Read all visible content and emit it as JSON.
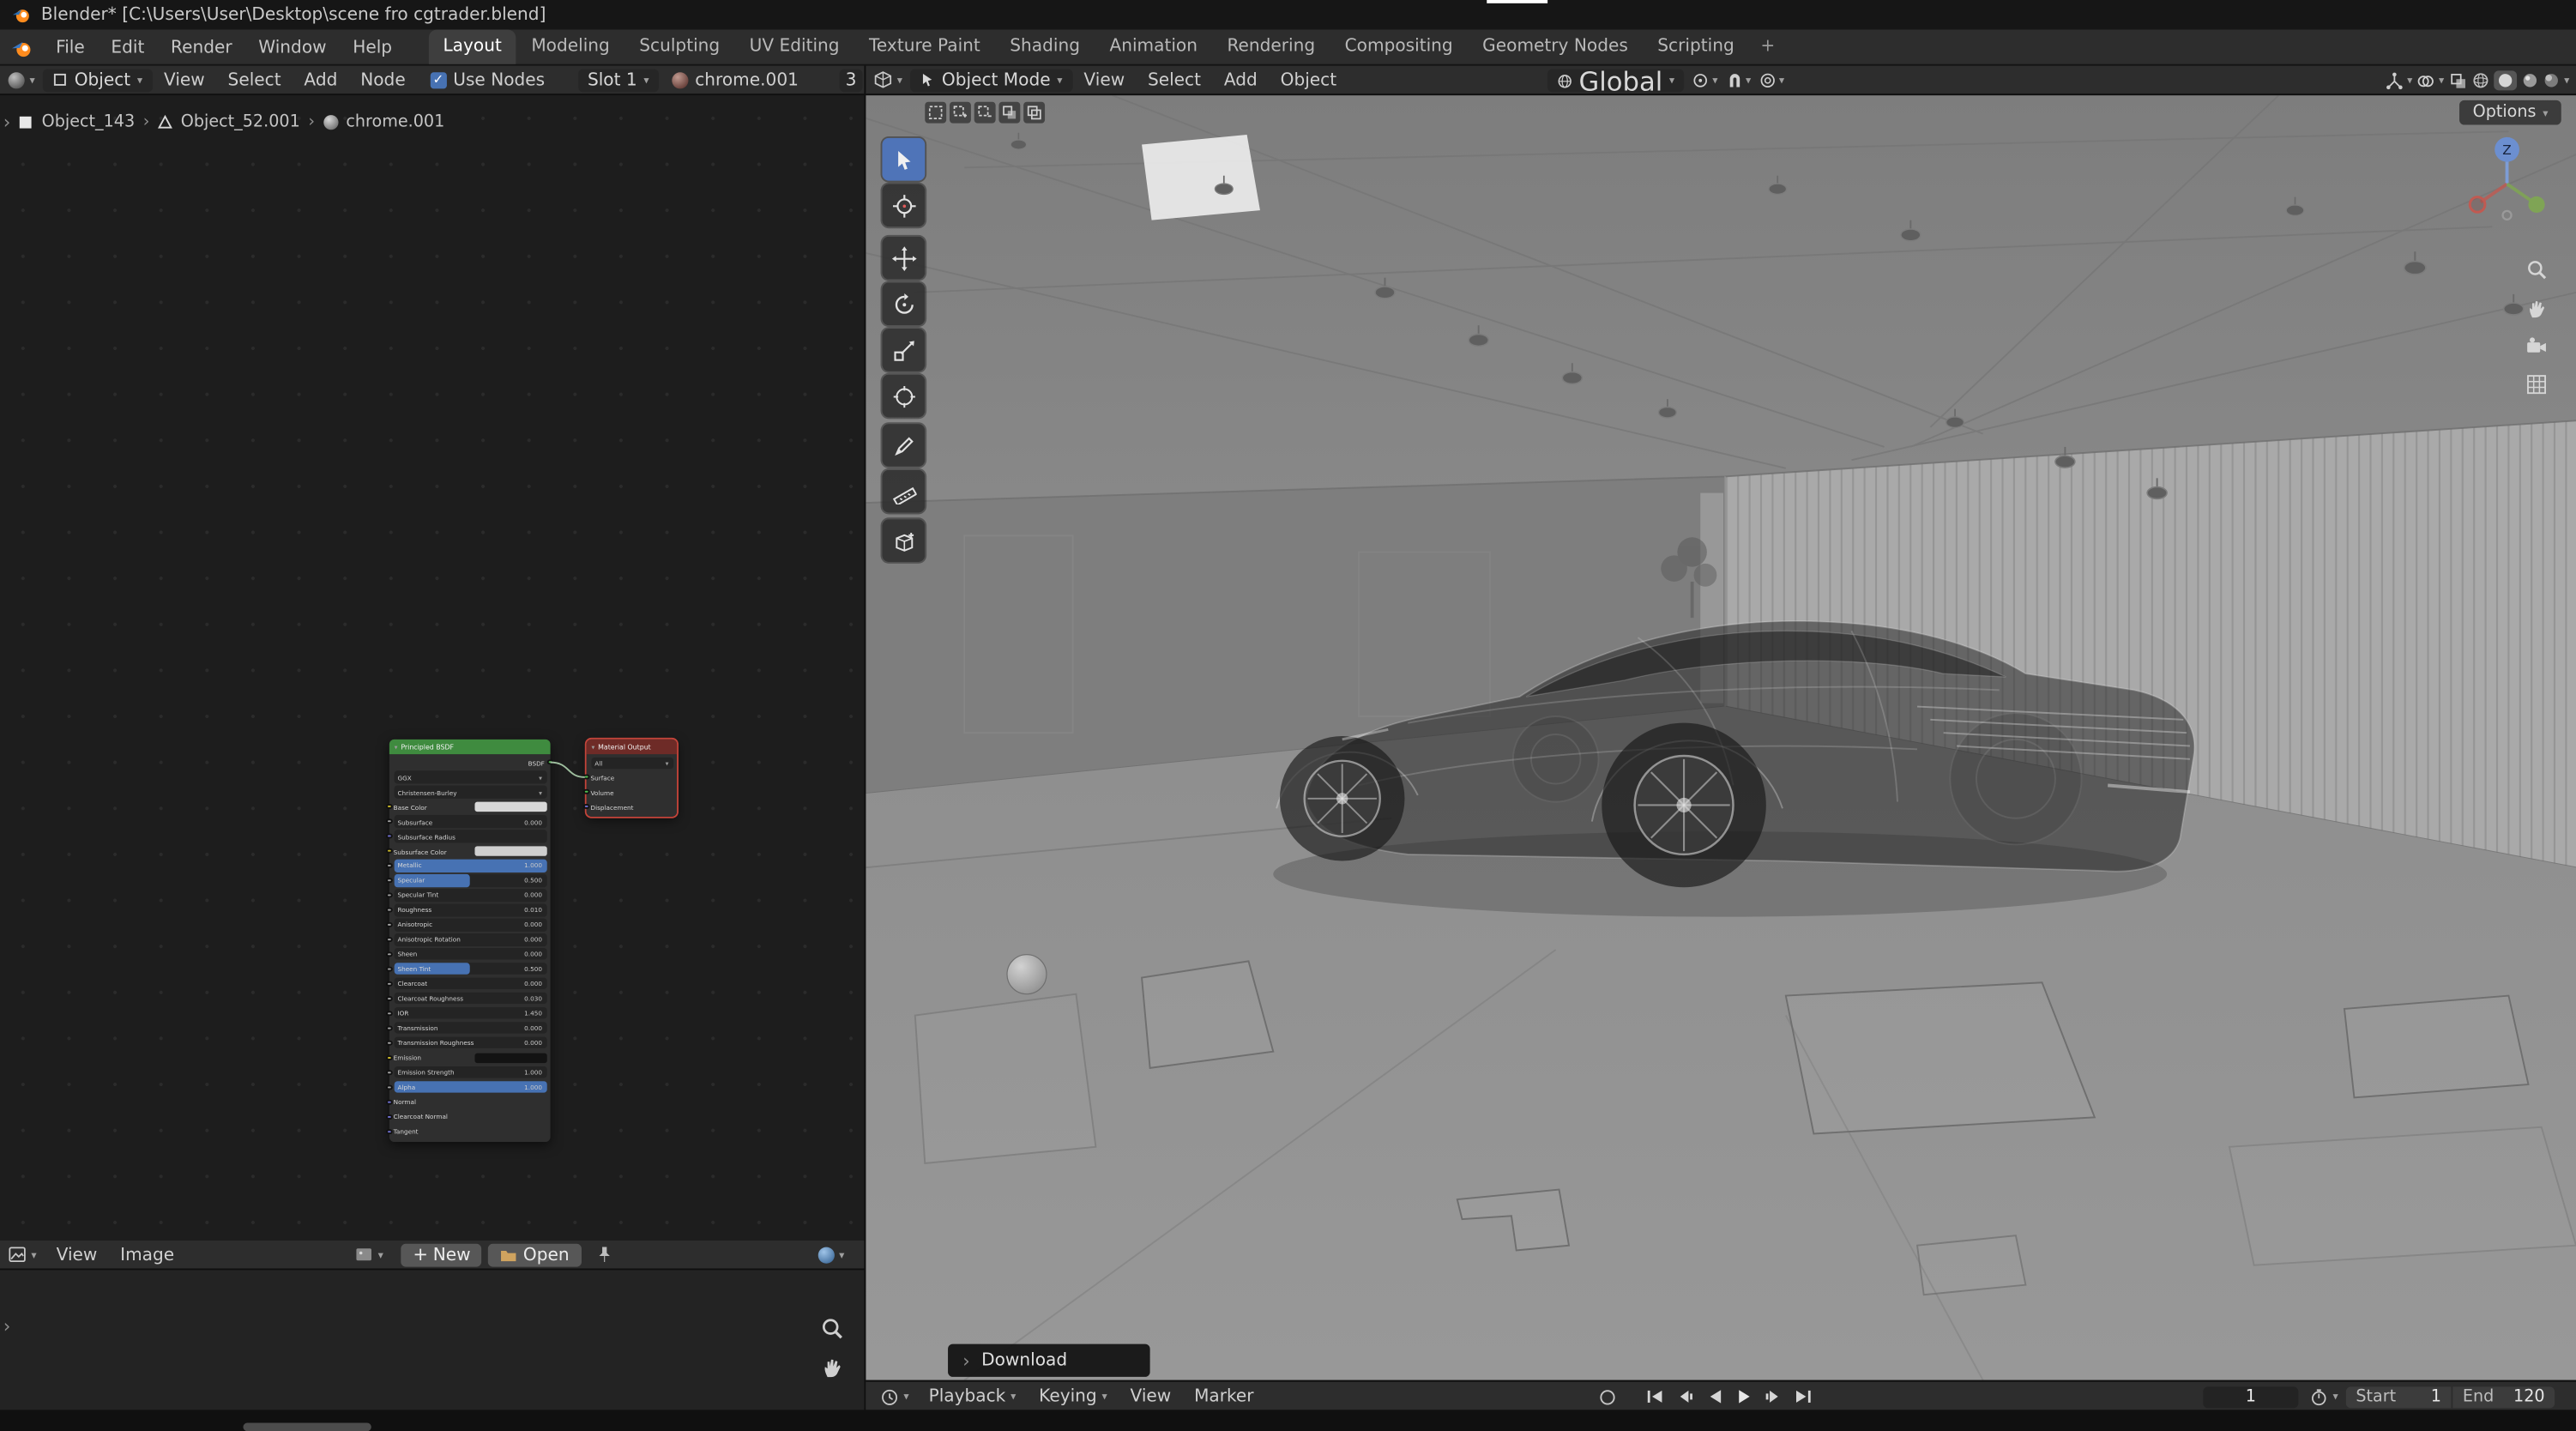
{
  "window": {
    "title": "Blender* [C:\\Users\\User\\Desktop\\scene fro cgtrader.blend]"
  },
  "topbar": {
    "app_menus": [
      "File",
      "Edit",
      "Render",
      "Window",
      "Help"
    ],
    "workspaces": [
      "Layout",
      "Modeling",
      "Sculpting",
      "UV Editing",
      "Texture Paint",
      "Shading",
      "Animation",
      "Rendering",
      "Compositing",
      "Geometry Nodes",
      "Scripting"
    ],
    "active_workspace": "Layout",
    "new_workspace_label": "+"
  },
  "shader_editor": {
    "header": {
      "shader_type": "Object",
      "menu_view": "View",
      "menu_select": "Select",
      "menu_add": "Add",
      "menu_node": "Node",
      "use_nodes_label": "Use Nodes",
      "slot_label": "Slot 1",
      "material_name": "chrome.001",
      "material_users": "3"
    },
    "breadcrumb": {
      "object": "Object_143",
      "mesh": "Object_52.001",
      "material": "chrome.001",
      "sep": "›"
    },
    "principled": {
      "title": "Principled BSDF",
      "output_label": "BSDF",
      "distribution": "GGX",
      "subsurface_method": "Christensen-Burley",
      "rows": [
        {
          "label": "Base Color"
        },
        {
          "label": "Subsurface",
          "value": "0.000"
        },
        {
          "label": "Subsurface Radius"
        },
        {
          "label": "Subsurface Color"
        },
        {
          "label": "Metallic",
          "value": "1.000"
        },
        {
          "label": "Specular",
          "value": "0.500"
        },
        {
          "label": "Specular Tint",
          "value": "0.000"
        },
        {
          "label": "Roughness",
          "value": "0.010"
        },
        {
          "label": "Anisotropic",
          "value": "0.000"
        },
        {
          "label": "Anisotropic Rotation",
          "value": "0.000"
        },
        {
          "label": "Sheen",
          "value": "0.000"
        },
        {
          "label": "Sheen Tint",
          "value": "0.500"
        },
        {
          "label": "Clearcoat",
          "value": "0.000"
        },
        {
          "label": "Clearcoat Roughness",
          "value": "0.030"
        },
        {
          "label": "IOR",
          "value": "1.450"
        },
        {
          "label": "Transmission",
          "value": "0.000"
        },
        {
          "label": "Transmission Roughness",
          "value": "0.000"
        },
        {
          "label": "Emission"
        },
        {
          "label": "Emission Strength",
          "value": "1.000"
        },
        {
          "label": "Alpha",
          "value": "1.000"
        },
        {
          "label": "Normal"
        },
        {
          "label": "Clearcoat Normal"
        },
        {
          "label": "Tangent"
        }
      ]
    },
    "material_output": {
      "title": "Material Output",
      "target": "All",
      "input_surface": "Surface",
      "input_volume": "Volume",
      "input_displacement": "Displacement"
    }
  },
  "image_editor": {
    "menu_view": "View",
    "menu_image": "Image",
    "new_label": "New",
    "open_label": "Open"
  },
  "viewport": {
    "mode": "Object Mode",
    "menu_view": "View",
    "menu_select": "Select",
    "menu_add": "Add",
    "menu_object": "Object",
    "orientation": "Global",
    "options_label": "Options",
    "axis_z": "Z",
    "download_label": "Download",
    "download_arrow": "›"
  },
  "timeline": {
    "menu_playback": "Playback",
    "menu_keying": "Keying",
    "menu_view": "View",
    "menu_marker": "Marker",
    "current_frame": "1",
    "start_label": "Start",
    "start_value": "1",
    "end_label": "End",
    "end_value": "120"
  }
}
